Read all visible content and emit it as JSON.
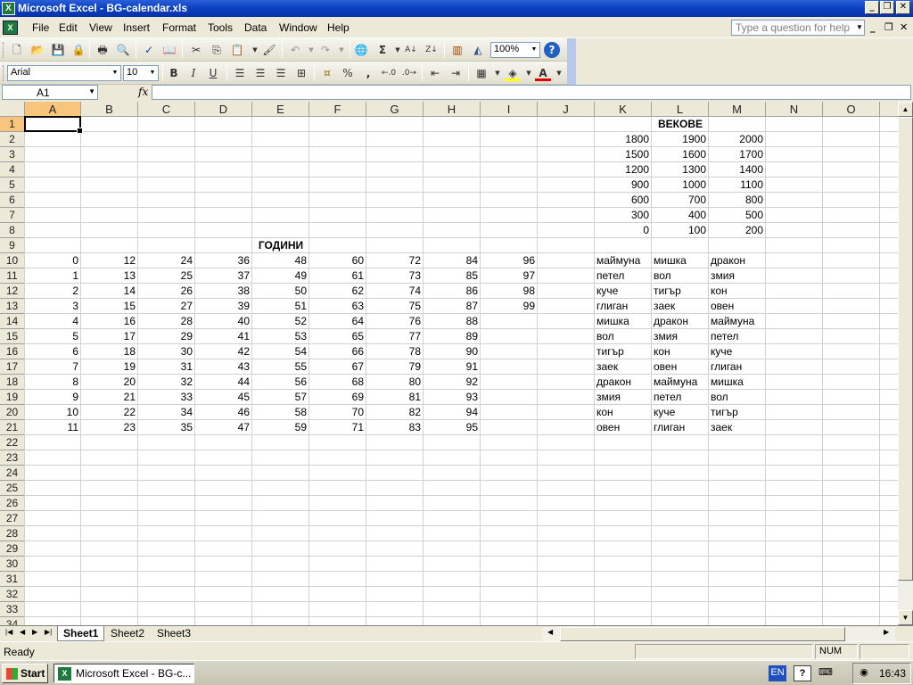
{
  "window": {
    "title": "Microsoft Excel - BG-calendar.xls",
    "app_icon": "X"
  },
  "menu": {
    "items": [
      "File",
      "Edit",
      "View",
      "Insert",
      "Format",
      "Tools",
      "Data",
      "Window",
      "Help"
    ],
    "help_placeholder": "Type a question for help"
  },
  "toolbar": {
    "zoom": "100%"
  },
  "format_toolbar": {
    "font": "Arial",
    "size": "10",
    "bold": "B",
    "italic": "I",
    "underline": "U",
    "percent": "%",
    "comma": ","
  },
  "formula_bar": {
    "name_box": "A1",
    "fx": "fx",
    "value": ""
  },
  "columns": [
    "A",
    "B",
    "C",
    "D",
    "E",
    "F",
    "G",
    "H",
    "I",
    "J",
    "K",
    "L",
    "M",
    "N",
    "O"
  ],
  "rows": [
    "1",
    "2",
    "3",
    "4",
    "5",
    "6",
    "7",
    "8",
    "9",
    "10",
    "11",
    "12",
    "13",
    "14",
    "15",
    "16",
    "17",
    "18",
    "19",
    "20",
    "21",
    "22",
    "23",
    "24",
    "25",
    "26",
    "27",
    "28",
    "29",
    "30",
    "31",
    "32",
    "33",
    "34"
  ],
  "cells": {
    "L1": "ВЕКОВЕ",
    "E9": "ГОДИНИ",
    "centuries": [
      [
        "1800",
        "1900",
        "2000"
      ],
      [
        "1500",
        "1600",
        "1700"
      ],
      [
        "1200",
        "1300",
        "1400"
      ],
      [
        "900",
        "1000",
        "1100"
      ],
      [
        "600",
        "700",
        "800"
      ],
      [
        "300",
        "400",
        "500"
      ],
      [
        "0",
        "100",
        "200"
      ]
    ],
    "years": [
      [
        "0",
        "12",
        "24",
        "36",
        "48",
        "60",
        "72",
        "84",
        "96"
      ],
      [
        "1",
        "13",
        "25",
        "37",
        "49",
        "61",
        "73",
        "85",
        "97"
      ],
      [
        "2",
        "14",
        "26",
        "38",
        "50",
        "62",
        "74",
        "86",
        "98"
      ],
      [
        "3",
        "15",
        "27",
        "39",
        "51",
        "63",
        "75",
        "87",
        "99"
      ],
      [
        "4",
        "16",
        "28",
        "40",
        "52",
        "64",
        "76",
        "88",
        ""
      ],
      [
        "5",
        "17",
        "29",
        "41",
        "53",
        "65",
        "77",
        "89",
        ""
      ],
      [
        "6",
        "18",
        "30",
        "42",
        "54",
        "66",
        "78",
        "90",
        ""
      ],
      [
        "7",
        "19",
        "31",
        "43",
        "55",
        "67",
        "79",
        "91",
        ""
      ],
      [
        "8",
        "20",
        "32",
        "44",
        "56",
        "68",
        "80",
        "92",
        ""
      ],
      [
        "9",
        "21",
        "33",
        "45",
        "57",
        "69",
        "81",
        "93",
        ""
      ],
      [
        "10",
        "22",
        "34",
        "46",
        "58",
        "70",
        "82",
        "94",
        ""
      ],
      [
        "11",
        "23",
        "35",
        "47",
        "59",
        "71",
        "83",
        "95",
        ""
      ]
    ],
    "animals": [
      [
        "маймуна",
        "мишка",
        "дракон"
      ],
      [
        "петел",
        "вол",
        "змия"
      ],
      [
        "куче",
        "тигър",
        "кон"
      ],
      [
        "глиган",
        "заек",
        "овен"
      ],
      [
        "мишка",
        "дракон",
        "маймуна"
      ],
      [
        "вол",
        "змия",
        "петел"
      ],
      [
        "тигър",
        "кон",
        "куче"
      ],
      [
        "заек",
        "овен",
        "глиган"
      ],
      [
        "дракон",
        "маймуна",
        "мишка"
      ],
      [
        "змия",
        "петел",
        "вол"
      ],
      [
        "кон",
        "куче",
        "тигър"
      ],
      [
        "овен",
        "глиган",
        "заек"
      ]
    ]
  },
  "sheets": [
    "Sheet1",
    "Sheet2",
    "Sheet3"
  ],
  "status": {
    "text": "Ready",
    "num": "NUM"
  },
  "taskbar": {
    "start": "Start",
    "task": "Microsoft Excel - BG-c...",
    "lang": "EN",
    "clock": "16:43"
  },
  "colors": {
    "selected_header": "#F7C67C",
    "title_bar": "#0A3FC0",
    "grid_line": "#D0D0D0"
  }
}
